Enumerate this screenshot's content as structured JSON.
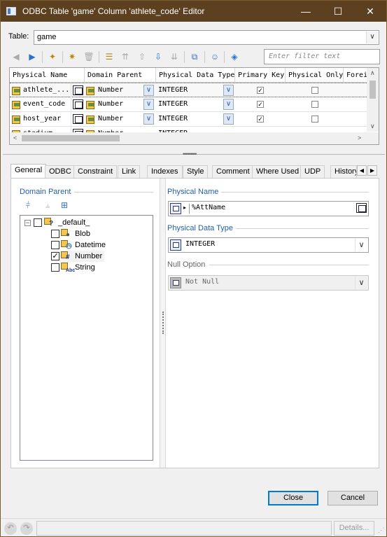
{
  "window": {
    "title": "ODBC Table 'game' Column 'athlete_code' Editor"
  },
  "table_selector": {
    "label": "Table:",
    "value": "game"
  },
  "filter": {
    "placeholder": "Enter filter text"
  },
  "grid": {
    "columns": [
      "Physical Name",
      "Domain Parent",
      "Physical Data Type",
      "Primary Key",
      "Physical Only",
      "Forei"
    ],
    "rows": [
      {
        "name": "athlete_...",
        "domain": "Number",
        "type": "INTEGER",
        "pk": true,
        "physical_only": false,
        "selected": true
      },
      {
        "name": "event_code",
        "domain": "Number",
        "type": "INTEGER",
        "pk": true,
        "physical_only": false,
        "selected": false
      },
      {
        "name": "host_year",
        "domain": "Number",
        "type": "INTEGER",
        "pk": true,
        "physical_only": false,
        "selected": false
      },
      {
        "name": "stadium_...",
        "domain": "Number",
        "type": "INTEGER",
        "pk": false,
        "physical_only": false,
        "selected": false
      }
    ]
  },
  "tabs": [
    "General",
    "ODBC",
    "Constraint",
    "Link",
    "Indexes",
    "Style",
    "Comment",
    "Where Used",
    "UDP",
    "History"
  ],
  "active_tab": "General",
  "general": {
    "domain_parent_label": "Domain Parent",
    "tree": {
      "root": {
        "label": "_default_",
        "checked": false
      },
      "children": [
        {
          "label": "Blob",
          "checked": false
        },
        {
          "label": "Datetime",
          "checked": false
        },
        {
          "label": "Number",
          "checked": true
        },
        {
          "label": "String",
          "checked": false
        }
      ]
    },
    "physical_name_label": "Physical Name",
    "physical_name_value": "%AttName",
    "physical_data_type_label": "Physical Data Type",
    "physical_data_type_value": "INTEGER",
    "null_option_label": "Null Option",
    "null_option_value": "Not Null"
  },
  "buttons": {
    "close": "Close",
    "cancel": "Cancel",
    "details": "Details..."
  },
  "colors": {
    "titlebar": "#5c4020",
    "accent": "#0078d7",
    "group_header": "#1f5fa8"
  }
}
